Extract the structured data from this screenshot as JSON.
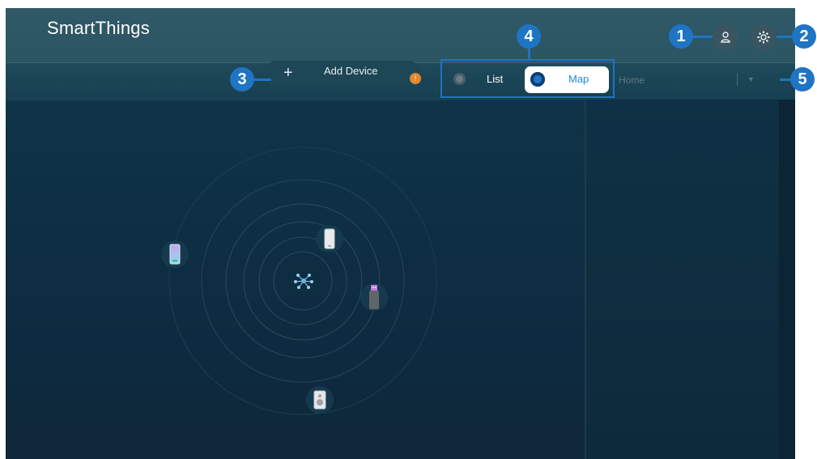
{
  "header": {
    "app_title": "SmartThings",
    "account_icon": "person-icon",
    "settings_icon": "gear-icon"
  },
  "toolbar": {
    "add_device_icon": "plus-icon",
    "add_device_label": "Add Device",
    "view_options": [
      {
        "label": "List",
        "selected": false
      },
      {
        "label": "Map",
        "selected": true
      }
    ],
    "location_select_value": "Home"
  },
  "callouts": [
    "1",
    "2",
    "3",
    "4",
    "5"
  ],
  "map": {
    "devices": [
      {
        "name": "phone",
        "icon": "phone-icon"
      },
      {
        "name": "tv-remote",
        "icon": "remote-icon"
      },
      {
        "name": "usb-device",
        "icon": "usb-icon"
      },
      {
        "name": "speaker",
        "icon": "speaker-icon"
      }
    ],
    "hub_icon": "network-hub-icon"
  },
  "colors": {
    "accent_callout": "#1f74c4",
    "header_bg": "#2f5966",
    "screen_bg": "#0e2f44",
    "badge_orange": "#e8872a"
  }
}
